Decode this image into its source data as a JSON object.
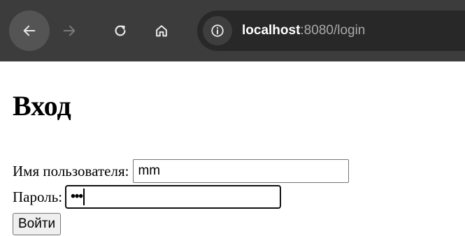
{
  "browser": {
    "url_host": "localhost",
    "url_rest": ":8080/login"
  },
  "page": {
    "title": "Вход",
    "username_label": "Имя пользователя:",
    "username_value": "mm",
    "password_label": "Пароль:",
    "password_masked": "•••",
    "submit_label": "Войти"
  },
  "icons": {
    "back": "back-arrow-icon",
    "forward": "forward-arrow-icon",
    "reload": "reload-icon",
    "home": "home-icon",
    "info": "info-icon"
  }
}
